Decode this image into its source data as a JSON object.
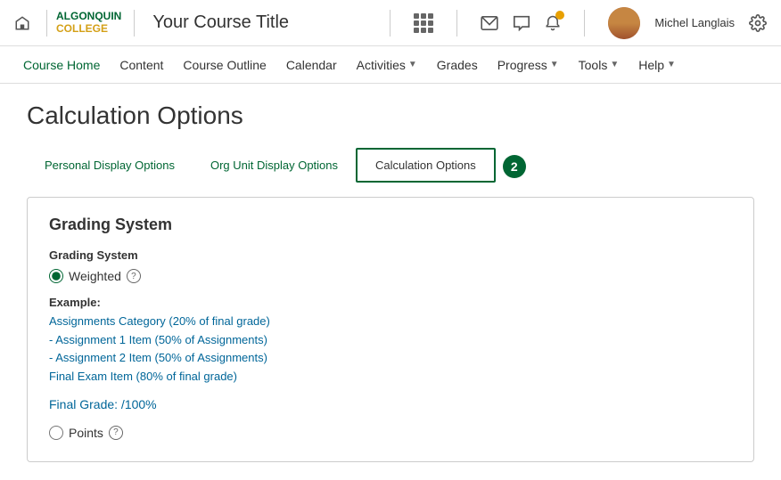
{
  "header": {
    "course_title": "Your Course Title",
    "username": "Michel Langlais"
  },
  "nav": {
    "items": [
      {
        "label": "Course Home",
        "active": true,
        "has_arrow": false
      },
      {
        "label": "Content",
        "active": false,
        "has_arrow": false
      },
      {
        "label": "Course Outline",
        "active": false,
        "has_arrow": false
      },
      {
        "label": "Calendar",
        "active": false,
        "has_arrow": false
      },
      {
        "label": "Activities",
        "active": false,
        "has_arrow": true
      },
      {
        "label": "Grades",
        "active": false,
        "has_arrow": false
      },
      {
        "label": "Progress",
        "active": false,
        "has_arrow": true
      },
      {
        "label": "Tools",
        "active": false,
        "has_arrow": true
      },
      {
        "label": "Help",
        "active": false,
        "has_arrow": true
      }
    ]
  },
  "page": {
    "title": "Calculation Options",
    "tabs": [
      {
        "label": "Personal Display Options",
        "active": false
      },
      {
        "label": "Org Unit Display Options",
        "active": false
      },
      {
        "label": "Calculation Options",
        "active": true
      }
    ],
    "tab_badge": "2",
    "grading_section": {
      "title": "Grading System",
      "field_label": "Grading System",
      "weighted_label": "Weighted",
      "example_label": "Example:",
      "example_line1": "Assignments Category (20% of final grade)",
      "example_line2": "- Assignment 1 Item (50% of Assignments)",
      "example_line3": "- Assignment 2 Item (50% of Assignments)",
      "example_line4": "Final Exam Item (80% of final grade)",
      "final_grade_label": "Final Grade: /100%",
      "points_label": "Points"
    }
  }
}
